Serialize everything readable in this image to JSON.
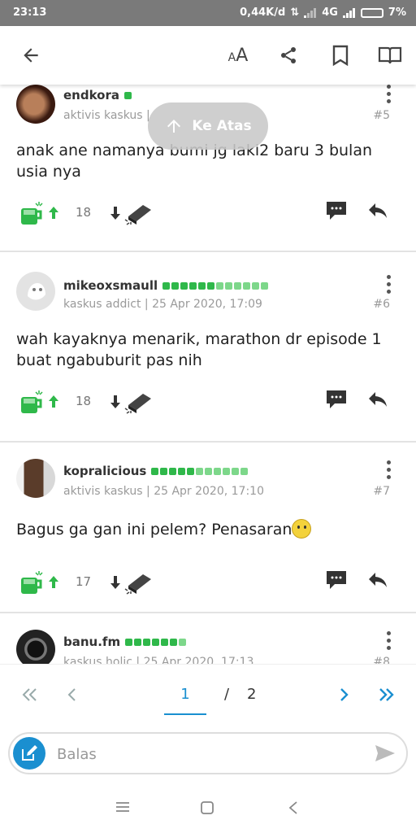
{
  "status_bar": {
    "time": "23:13",
    "network_speed": "0,44K/d",
    "network_type": "4G",
    "battery": "7%"
  },
  "toolbar": {
    "back_icon": "back-arrow-icon",
    "font_size_icon": "font-size-icon",
    "share_icon": "share-icon",
    "bookmark_icon": "bookmark-icon",
    "read_icon": "open-book-icon"
  },
  "scroll_top": {
    "label": "Ke Atas"
  },
  "posts": [
    {
      "username": "endkora",
      "role": "aktivis kaskus |",
      "date": "",
      "number": "#5",
      "text": "anak ane namanya bumi jg laki2 baru 3 bulan usia nya",
      "cendol": "18"
    },
    {
      "username": "mikeoxsmaull",
      "role": "kaskus addict",
      "date": "25 Apr 2020, 17:09",
      "number": "#6",
      "text": "wah kayaknya menarik, marathon dr episode 1 buat ngabuburit pas nih",
      "cendol": "18"
    },
    {
      "username": "kopralicious",
      "role": "aktivis kaskus",
      "date": "25 Apr 2020, 17:10",
      "number": "#7",
      "text": "Bagus ga gan ini pelem? Penasaran",
      "cendol": "17"
    },
    {
      "username": "banu.fm",
      "role": "kaskus holic",
      "date": "25 Apr 2020, 17:13",
      "number": "#8",
      "text": "",
      "cendol": ""
    }
  ],
  "pager": {
    "current": "1",
    "separator": "/",
    "total": "2"
  },
  "reply": {
    "placeholder": "Balas"
  },
  "colors": {
    "accent": "#1a8fd0",
    "cendol_green": "#2fb84a",
    "status_bar": "#7a7a7a"
  }
}
